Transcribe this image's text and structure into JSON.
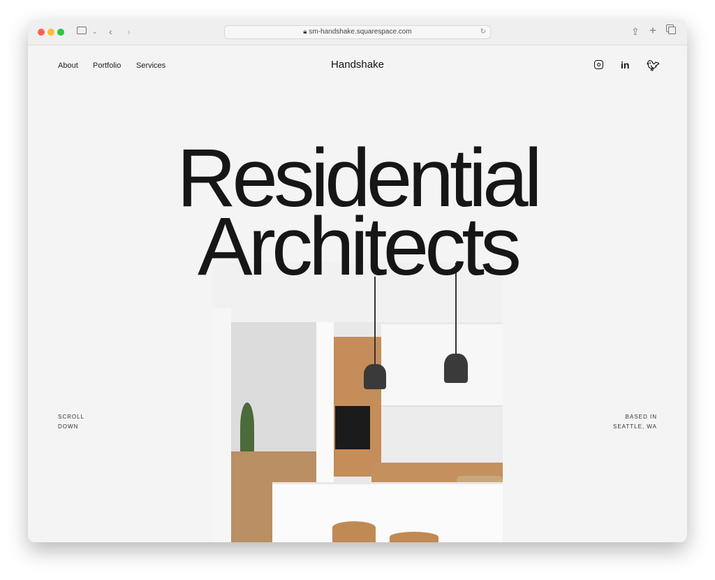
{
  "browser": {
    "url": "sm-handshake.squarespace.com"
  },
  "nav": {
    "items": [
      "About",
      "Portfolio",
      "Services"
    ],
    "brand": "Handshake"
  },
  "social": [
    "instagram-icon",
    "linkedin-icon",
    "twitter-icon"
  ],
  "hero": {
    "line1": "Residential",
    "line2": "Architects"
  },
  "left_note": [
    "SCROLL",
    "DOWN"
  ],
  "right_note": [
    "BASED IN",
    "SEATTLE, WA"
  ]
}
